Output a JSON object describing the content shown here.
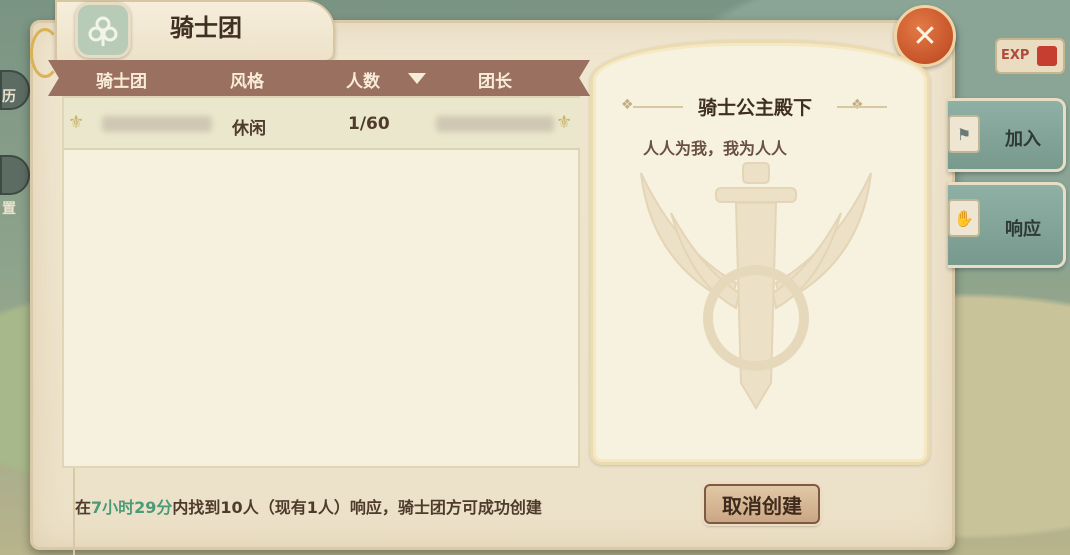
{
  "window": {
    "title": "骑士团",
    "close_icon": "close-icon"
  },
  "background": {
    "left_labels": [
      "历",
      "置"
    ],
    "exp_badge": "EXP"
  },
  "table": {
    "headers": [
      "骑士团",
      "风格",
      "人数",
      "团长"
    ],
    "sort_icon": "sort-desc-arrow",
    "rows": [
      {
        "name": "",
        "style": "休闲",
        "members": "1/60",
        "leader": ""
      }
    ]
  },
  "detail": {
    "title": "骑士公主殿下",
    "motto": "人人为我，我为人人"
  },
  "side_buttons": [
    {
      "label": "加入",
      "icon": "flag-icon"
    },
    {
      "label": "响应",
      "icon": "hand-icon"
    }
  ],
  "footer": {
    "pre": "在",
    "time": "7小时29分",
    "post": "内找到10人（现有1人）响应，骑士团方可成功创建",
    "cancel_label": "取消创建"
  },
  "colors": {
    "header_bg": "#9a7160",
    "highlight_time": "#4b9a78",
    "close_button": "#c6542a",
    "side_button": "#8fb0a5"
  }
}
